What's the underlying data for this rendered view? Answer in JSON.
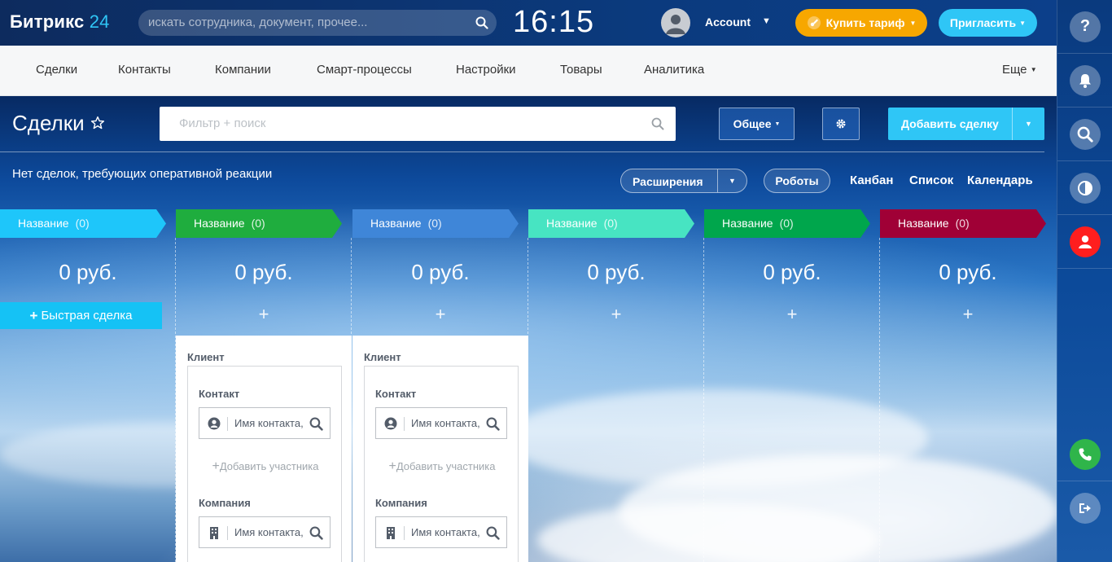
{
  "topbar": {
    "logo_word": "Битрикс",
    "logo_num": "24",
    "search_placeholder": "искать сотрудника, документ, прочее...",
    "clock": "16:15",
    "account": "Account",
    "buy_label": "Купить тариф",
    "invite_label": "Пригласить"
  },
  "menu": {
    "items": [
      "Сделки",
      "Контакты",
      "Компании",
      "Смарт-процессы",
      "Настройки",
      "Товары",
      "Аналитика"
    ],
    "more": "Еще"
  },
  "page": {
    "title": "Сделки",
    "filter_placeholder": "Фильтр + поиск",
    "general_label": "Общее",
    "add_label": "Добавить сделку",
    "notice": "Нет сделок, требующих оперативной реакции",
    "extensions_label": "Расширения",
    "robots_label": "Роботы",
    "views": [
      "Канбан",
      "Список",
      "Календарь"
    ]
  },
  "columns": [
    {
      "name": "Название",
      "count": "(0)",
      "sum": "0 руб.",
      "color": "#1ec6fa"
    },
    {
      "name": "Название",
      "count": "(0)",
      "sum": "0 руб.",
      "color": "#1fad3e"
    },
    {
      "name": "Название",
      "count": "(0)",
      "sum": "0 руб.",
      "color": "#3f86d8"
    },
    {
      "name": "Название",
      "count": "(0)",
      "sum": "0 руб.",
      "color": "#47e4c2"
    },
    {
      "name": "Название",
      "count": "(0)",
      "sum": "0 руб.",
      "color": "#00a64c"
    },
    {
      "name": "Название",
      "count": "(0)",
      "sum": "0 руб.",
      "color": "#a00036"
    }
  ],
  "quick_deal": "Быстрая сделка",
  "plus": "+",
  "form": {
    "client": "Клиент",
    "contact": "Контакт",
    "contact_placeholder": "Имя контакта,",
    "add_member": "Добавить участника",
    "company": "Компания",
    "company_placeholder": "Имя контакта,"
  },
  "rightbar": [
    "help-icon",
    "bell-icon",
    "search-icon",
    "theme-icon",
    "user-icon",
    "phone-icon",
    "logout-icon"
  ]
}
